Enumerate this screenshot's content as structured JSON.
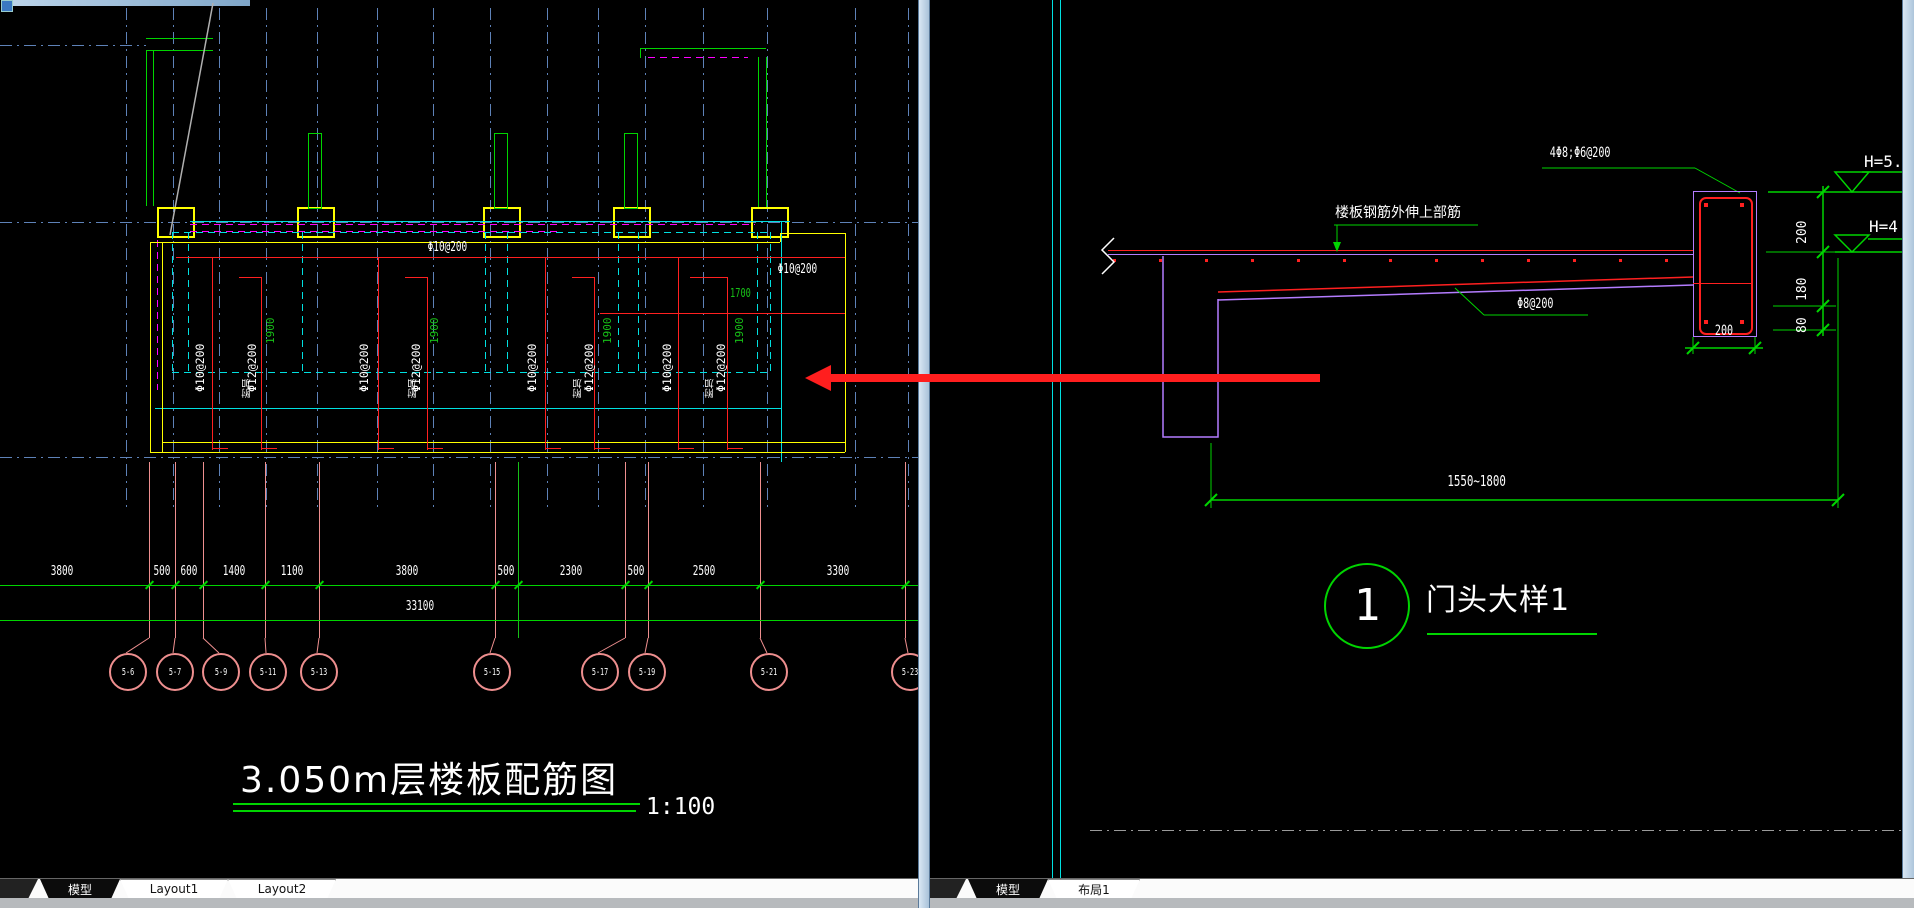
{
  "left": {
    "plan": {
      "top_bar_label": "Φ10@200",
      "right_bar_label": "Φ10@200",
      "len_1700": "1700",
      "cols": [
        {
          "spec": "Φ10@200"
        },
        {
          "spec": "Φ12@200",
          "len": "1900"
        },
        {
          "spec": "Φ10@200"
        },
        {
          "spec": "Φ12@200",
          "len": "1900"
        },
        {
          "spec": "Φ10@200"
        },
        {
          "spec": "Φ12@200",
          "len": "1900"
        },
        {
          "spec": "Φ10@200"
        },
        {
          "spec": "Φ12@200",
          "len": "1900"
        }
      ],
      "extra": [
        "附加",
        "附加",
        "附加",
        "附加"
      ]
    },
    "dims": {
      "row1": [
        "3800",
        "500",
        "600",
        "1400",
        "1100",
        "3800",
        "500",
        "2300",
        "500",
        "2500",
        "3300"
      ],
      "total": "33100"
    },
    "bubbles": [
      "5-6",
      "5-7",
      "5-9",
      "5-11",
      "5-13",
      "5-15",
      "5-17",
      "5-19",
      "5-21",
      "5-23"
    ],
    "title": "3.050m层楼板配筋图",
    "scale": "1:100",
    "tabs": {
      "model": "模型",
      "layout1": "Layout1",
      "layout2": "Layout2"
    }
  },
  "right": {
    "labels": {
      "top_bars": "4Φ8;Φ6@200",
      "slab_note": "楼板钢筋外伸上部筋",
      "bottom_bars": "Φ8@200"
    },
    "levels": {
      "h5": "H=5.",
      "h4": "H=4"
    },
    "vdims": [
      "200",
      "180",
      "80"
    ],
    "beam_width": "200",
    "span": "1550~1800",
    "detail_no": "1",
    "detail_title": "门头大样1",
    "tabs": {
      "model": "模型",
      "layout1": "布局1"
    }
  },
  "colors": {
    "dim_green": "#00d400",
    "grid_blue": "#5e82b8",
    "axis_salmon": "#ee8f8f",
    "rebar_red": "#ff2020",
    "slab_yellow": "#ffff00",
    "panel_cyan": "#00e0e0",
    "wall_magenta": "#ff00ff",
    "beam_purple": "#b47cff",
    "annotation_arrow": "#ff1e1e"
  }
}
